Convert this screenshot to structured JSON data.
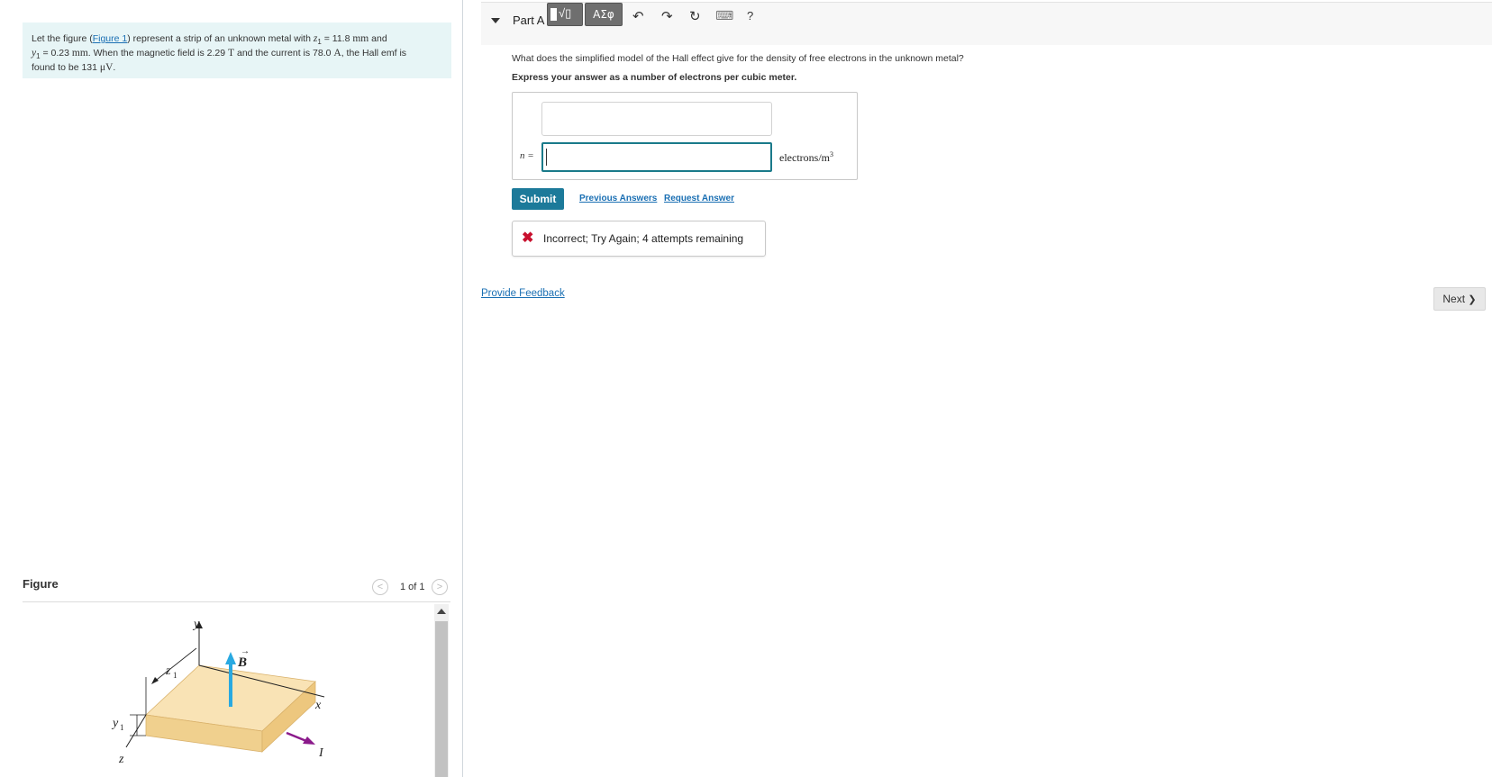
{
  "problem": {
    "t1": "Let the figure (",
    "figure_link": "Figure 1",
    "t2": ") represent a strip of an unknown metal with ",
    "z1_sym": "z",
    "z1_sub": "1",
    "t3": " = 11.8 ",
    "mm1": "mm",
    "t4": " and",
    "y1_sym": "y",
    "y1_sub": "1",
    "t5": " = 0.23 ",
    "mm2": "mm",
    "t6": ". When the magnetic field is 2.29 ",
    "tesla": "T",
    "t7": " and the current is 78.0 ",
    "amp": "A",
    "t8": ", the Hall emf is",
    "t9": "found to be 131 ",
    "microvolt": "μV",
    "t10": "."
  },
  "figure": {
    "label": "Figure",
    "pager_text": "1 of 1",
    "prev_glyph": "<",
    "next_glyph": ">",
    "labels": {
      "y_axis": "y",
      "x_axis": "x",
      "z_axis": "z",
      "b_field": "B",
      "current": "I",
      "z1": "z",
      "z1_sub": "1",
      "y1": "y",
      "y1_sub": "1"
    },
    "colors": {
      "strip_top": "#f9e3b5",
      "strip_side": "#f0d08e",
      "b_arrow": "#29a9e1",
      "current_arrow": "#8b1a8b"
    }
  },
  "part": {
    "title": "Part A",
    "question": "What does the simplified model of the Hall effect give for the density of free electrons in the unknown metal?",
    "instruction": "Express your answer as a number of electrons per cubic meter.",
    "toolbar": {
      "template_label": "√▯",
      "greek_label": "ΑΣφ",
      "undo": "↶",
      "redo": "↷",
      "reset": "↻",
      "keyboard": "⌨",
      "help": "?"
    },
    "input_label": "n =",
    "input_value": "",
    "unit": "electrons/m",
    "unit_exp": "3",
    "submit": "Submit",
    "previous_answers": "Previous Answers",
    "request_answer": "Request Answer",
    "feedback": "Incorrect; Try Again; 4 attempts remaining",
    "feedback_icon": "✖"
  },
  "provide_feedback": "Provide Feedback",
  "next": "Next",
  "next_glyph": "❯"
}
